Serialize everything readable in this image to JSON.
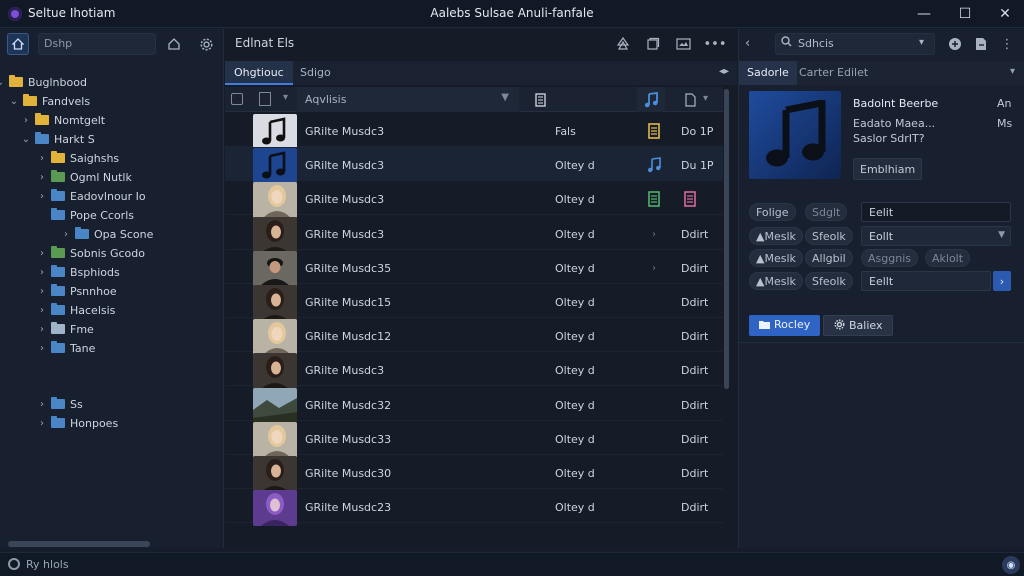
{
  "titlebar": {
    "app_title": "Seltue Ihotiam",
    "window_title": "Aalebs Sulsae Anuli-fanfale",
    "minimize": "—",
    "maximize": "☐",
    "close": "✕"
  },
  "left": {
    "search_placeholder": "Dshp",
    "tree": [
      {
        "label": "Buglnbood",
        "depth": 0,
        "color": "yellow",
        "expanded": true,
        "has_children": true
      },
      {
        "label": "Fandvels",
        "depth": 1,
        "color": "yellow",
        "expanded": true,
        "has_children": true
      },
      {
        "label": "Nomtgelt",
        "depth": 2,
        "color": "yellow",
        "expanded": false,
        "has_children": true
      },
      {
        "label": "Harkt S",
        "depth": 2,
        "color": "blue",
        "expanded": true,
        "has_children": true
      },
      {
        "label": "Saighshs",
        "depth": 3,
        "color": "yellow",
        "expanded": false,
        "has_children": true
      },
      {
        "label": "Ogml Nutlk",
        "depth": 3,
        "color": "green",
        "expanded": false,
        "has_children": true
      },
      {
        "label": "Eadovlnour Io",
        "depth": 3,
        "color": "blue",
        "expanded": false,
        "has_children": true
      },
      {
        "label": "Pope Ccorls",
        "depth": 3,
        "color": "blue",
        "expanded": false,
        "has_children": false
      },
      {
        "label": "Opa Scone",
        "depth": 4,
        "color": "blue",
        "expanded": false,
        "has_children": true
      },
      {
        "label": "Sobnis Gcodo",
        "depth": 3,
        "color": "green",
        "expanded": false,
        "has_children": true
      },
      {
        "label": "Bsphiods",
        "depth": 3,
        "color": "blue",
        "expanded": false,
        "has_children": true
      },
      {
        "label": "Psnnhoe",
        "depth": 3,
        "color": "blue",
        "expanded": false,
        "has_children": true
      },
      {
        "label": "Hacelsis",
        "depth": 3,
        "color": "blue",
        "expanded": false,
        "has_children": true
      },
      {
        "label": "Fme",
        "depth": 3,
        "color": "light",
        "expanded": false,
        "has_children": true
      },
      {
        "label": "Tane",
        "depth": 3,
        "color": "blue",
        "expanded": false,
        "has_children": true
      },
      {
        "label": "Ss",
        "depth": 3,
        "color": "blue",
        "expanded": false,
        "has_children": true
      },
      {
        "label": "Honpoes",
        "depth": 3,
        "color": "blue",
        "expanded": false,
        "has_children": true
      }
    ]
  },
  "middle": {
    "toolbar_title": "Edlnat Els",
    "tabs": [
      "Ohgtiouc",
      "Sdigo"
    ],
    "column_artists": "Aqvlisis",
    "rows": [
      {
        "title": "GRilte Musdc3",
        "status": "Fals",
        "icon": "doc",
        "icon_color": "#e0b64a",
        "action": "Do 1P",
        "thumb": "note-light"
      },
      {
        "title": "GRilte Musdc3",
        "status": "Oltey d",
        "icon": "note",
        "icon_color": "#4a8fdc",
        "action": "Du 1P",
        "thumb": "note-blue"
      },
      {
        "title": "GRilte Musdc3",
        "status": "Oltey d",
        "icon": "doc",
        "icon_color": "#4db36a",
        "action": "",
        "thumb": "woman-light",
        "icon2_color": "#d76a9a"
      },
      {
        "title": "GRilte Musdc3",
        "status": "Oltey d",
        "icon": "chev",
        "icon_color": "#6a7484",
        "action": "Ddirt",
        "thumb": "woman-dark"
      },
      {
        "title": "GRilte Musdc35",
        "status": "Oltey d",
        "icon": "chev",
        "icon_color": "#6a7484",
        "action": "Ddirt",
        "thumb": "man-cap"
      },
      {
        "title": "GRilte Musdc15",
        "status": "Oltey d",
        "icon": "",
        "icon_color": "#6a7484",
        "action": "Ddirt",
        "thumb": "woman-dark"
      },
      {
        "title": "GRilte Musdc12",
        "status": "Oltey d",
        "icon": "",
        "icon_color": "#6a7484",
        "action": "Ddirt",
        "thumb": "woman-light"
      },
      {
        "title": "GRilte Musdc3",
        "status": "Oltey d",
        "icon": "",
        "icon_color": "#6a7484",
        "action": "Ddirt",
        "thumb": "woman-dark"
      },
      {
        "title": "GRilte Musdc32",
        "status": "Oltey d",
        "icon": "",
        "icon_color": "#6a7484",
        "action": "Ddirt",
        "thumb": "landscape"
      },
      {
        "title": "GRilte Musdc33",
        "status": "Oltey d",
        "icon": "",
        "icon_color": "#6a7484",
        "action": "Ddirt",
        "thumb": "woman-light"
      },
      {
        "title": "GRilte Musdc30",
        "status": "Oltey d",
        "icon": "",
        "icon_color": "#6a7484",
        "action": "Ddirt",
        "thumb": "woman-dark"
      },
      {
        "title": "GRilte Musdc23",
        "status": "Oltey d",
        "icon": "",
        "icon_color": "#6a7484",
        "action": "Ddirt",
        "thumb": "purple"
      }
    ]
  },
  "right": {
    "search_value": "Sdhcis",
    "tabs": [
      "Sadorle",
      "Carter Edilet"
    ],
    "album_name": "Badolnt Beerbe",
    "album_sub1": "Eadato Maea...",
    "album_sub2": "Saslor SdrIT?",
    "album_button": "Emblhiam",
    "side_a": "An",
    "side_b": "Ms",
    "chips_row1": [
      "Folige",
      "Sdglt"
    ],
    "field1": "Eelit",
    "chips_row2": [
      "▲Meslk",
      "Sfeolk"
    ],
    "field2": "Eollt",
    "chips_row3": [
      "▲Meslk",
      "Allgbil",
      "Asggnis",
      "Aklolt"
    ],
    "chips_row4": [
      "▲Meslk",
      "Sfeolk"
    ],
    "field4": "Eellt",
    "primary_button": "Rocley",
    "secondary_button": "Baliex"
  },
  "status": {
    "text": "Ry hlols"
  }
}
